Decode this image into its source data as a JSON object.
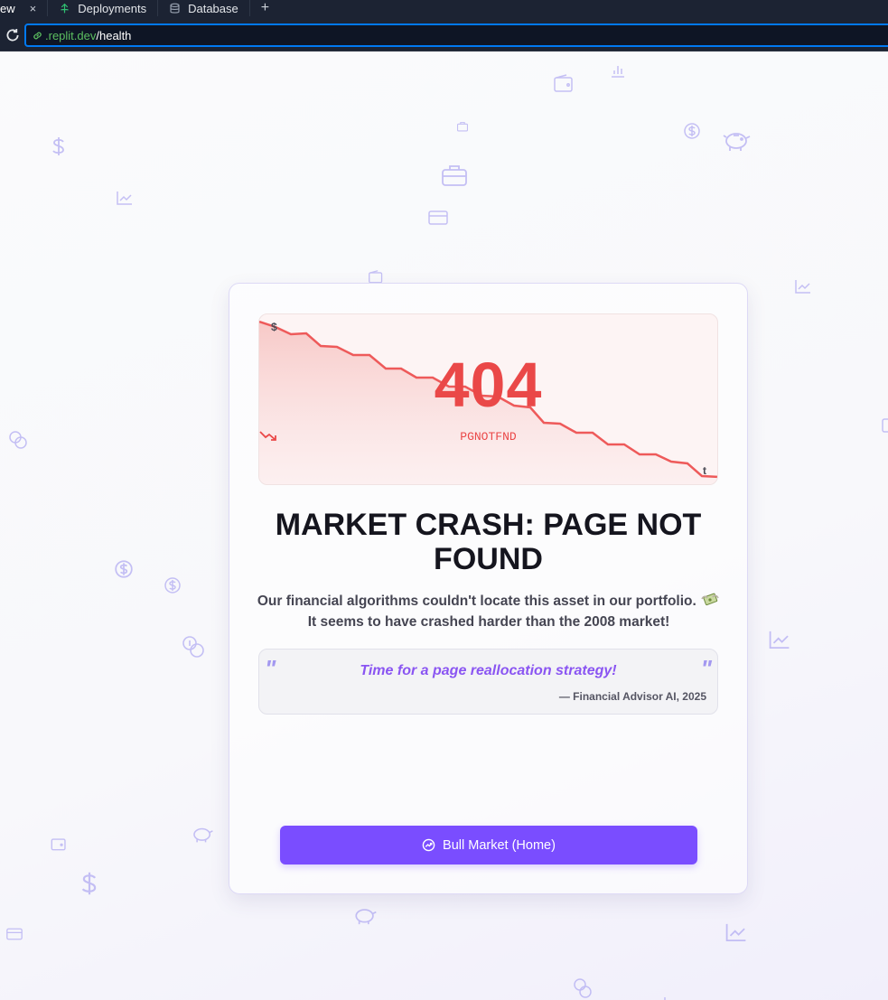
{
  "browser": {
    "tabs": [
      {
        "label": "ew",
        "active": true,
        "icon": "none"
      },
      {
        "label": "Deployments",
        "active": false,
        "icon": "deploy-icon"
      },
      {
        "label": "Database",
        "active": false,
        "icon": "database-icon"
      }
    ],
    "close_glyph": "×",
    "new_tab_glyph": "+",
    "url_domain": ".replit.dev",
    "url_path": "/health"
  },
  "error": {
    "code": "404",
    "error_code": "PGNOTFND",
    "axis_y": "$",
    "axis_x": "t",
    "title": "MARKET CRASH: PAGE NOT FOUND",
    "description_line1": "Our financial algorithms couldn't locate this asset in our portfolio.",
    "description_line2": "It seems to have crashed harder than the 2008 market!",
    "quote_open": "\"",
    "quote_close": "\"",
    "quote": "Time for a page reallocation strategy!",
    "quote_author": "— Financial Advisor AI, 2025",
    "home_button": "Bull Market (Home)"
  },
  "colors": {
    "accent": "#7a4dff",
    "danger": "#ea4848",
    "quote": "#8a55f2",
    "browser_bg": "#1c2333",
    "url_border": "#0079f2"
  }
}
